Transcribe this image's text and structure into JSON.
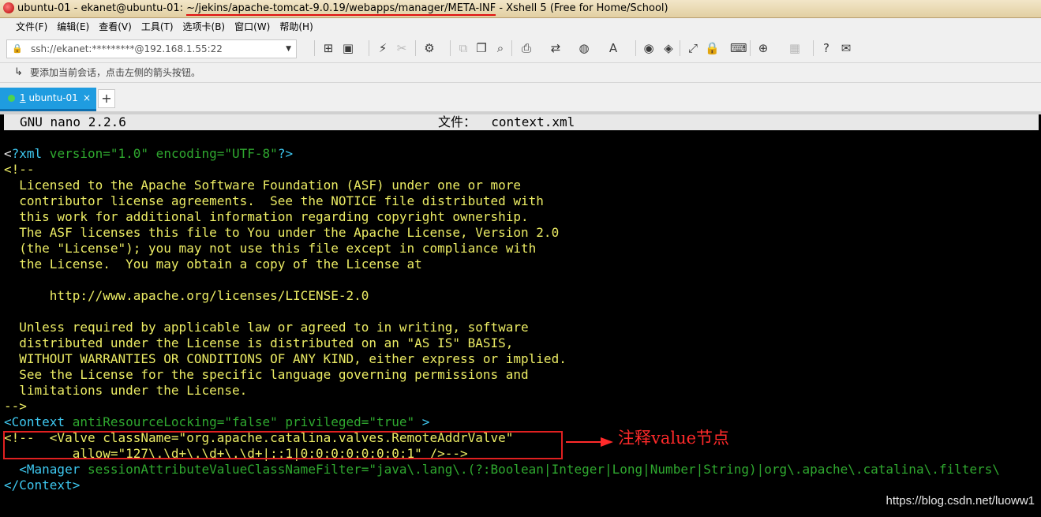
{
  "window": {
    "title_prefix": "ubuntu-01 - ekanet@ubuntu-01: ",
    "title_path": "~/jekins/apache-tomcat-9.0.19/webapps/manager/META-INF",
    "title_suffix": " - Xshell 5 (Free for Home/School)"
  },
  "menu": [
    "文件(F)",
    "编辑(E)",
    "查看(V)",
    "工具(T)",
    "选项卡(B)",
    "窗口(W)",
    "帮助(H)"
  ],
  "address": {
    "value": "ssh://ekanet:*********@192.168.1.55:22",
    "lock_glyph": "🔒",
    "dropdown_glyph": "▼"
  },
  "toolbar_icons": [
    {
      "name": "new-session-icon",
      "glyph": "⊞",
      "enabled": true
    },
    {
      "name": "open-folder-icon",
      "glyph": "▣",
      "enabled": true
    },
    {
      "name": "connect-icon",
      "glyph": "⚡",
      "enabled": true
    },
    {
      "name": "disconnect-icon",
      "glyph": "✂",
      "enabled": false
    },
    {
      "name": "properties-icon",
      "glyph": "⚙",
      "enabled": true
    },
    {
      "name": "copy-icon",
      "glyph": "⧉",
      "enabled": false
    },
    {
      "name": "paste-icon",
      "glyph": "❐",
      "enabled": true
    },
    {
      "name": "find-icon",
      "glyph": "⌕",
      "enabled": true
    },
    {
      "name": "print-icon",
      "glyph": "⎙",
      "enabled": true
    },
    {
      "name": "transfer-icon",
      "glyph": "⇄",
      "enabled": true
    },
    {
      "name": "globe-icon",
      "glyph": "◍",
      "enabled": true
    },
    {
      "name": "font-icon",
      "glyph": "A",
      "enabled": true
    },
    {
      "name": "xftp-icon",
      "glyph": "◉",
      "enabled": true
    },
    {
      "name": "xmanager-icon",
      "glyph": "◈",
      "enabled": true
    },
    {
      "name": "fullscreen-icon",
      "glyph": "⤢",
      "enabled": true
    },
    {
      "name": "lock-icon",
      "glyph": "🔒",
      "enabled": true
    },
    {
      "name": "keyboard-icon",
      "glyph": "⌨",
      "enabled": true
    },
    {
      "name": "add-tab-icon",
      "glyph": "⊕",
      "enabled": true
    },
    {
      "name": "layout-icon",
      "glyph": "▦",
      "enabled": false
    },
    {
      "name": "help-icon",
      "glyph": "?",
      "enabled": true
    },
    {
      "name": "chat-icon",
      "glyph": "✉",
      "enabled": true
    }
  ],
  "hint": {
    "icon_glyph": "↳",
    "text": "要添加当前会话，点击左侧的箭头按钮。"
  },
  "tabs": [
    {
      "number": "1",
      "label": " ubuntu-01",
      "close_glyph": "×",
      "status_color": "#4ed24e"
    }
  ],
  "add_tab_glyph": "+",
  "nano": {
    "version": "GNU nano 2.2.6",
    "file_label": "文件：  context.xml"
  },
  "colors": {
    "comment": "#ecec64",
    "tag": "#3ec8f0",
    "attribute": "#2fa82f",
    "value": "#ececec",
    "annotation": "#ff2a2a"
  },
  "editor_lines": [
    [
      {
        "t": "<",
        "c": "cursor"
      },
      {
        "t": "?xml",
        "c": "tag"
      },
      {
        "t": " version=",
        "c": "attr"
      },
      {
        "t": "\"1.0\"",
        "c": "attr"
      },
      {
        "t": " encoding=",
        "c": "attr"
      },
      {
        "t": "\"UTF-8\"",
        "c": "attr"
      },
      {
        "t": "?>",
        "c": "tag"
      }
    ],
    [
      {
        "t": "<!--",
        "c": "com"
      }
    ],
    [
      {
        "t": "  Licensed to the Apache Software Foundation (ASF) under one or more",
        "c": "com"
      }
    ],
    [
      {
        "t": "  contributor license agreements.  See the NOTICE file distributed with",
        "c": "com"
      }
    ],
    [
      {
        "t": "  this work for additional information regarding copyright ownership.",
        "c": "com"
      }
    ],
    [
      {
        "t": "  The ASF licenses this file to You under the Apache License, Version 2.0",
        "c": "com"
      }
    ],
    [
      {
        "t": "  (the \"License\"); you may not use this file except in compliance with",
        "c": "com"
      }
    ],
    [
      {
        "t": "  the License.  You may obtain a copy of the License at",
        "c": "com"
      }
    ],
    [
      {
        "t": "",
        "c": "com"
      }
    ],
    [
      {
        "t": "      http://www.apache.org/licenses/LICENSE-2.0",
        "c": "com"
      }
    ],
    [
      {
        "t": "",
        "c": "com"
      }
    ],
    [
      {
        "t": "  Unless required by applicable law or agreed to in writing, software",
        "c": "com"
      }
    ],
    [
      {
        "t": "  distributed under the License is distributed on an \"AS IS\" BASIS,",
        "c": "com"
      }
    ],
    [
      {
        "t": "  WITHOUT WARRANTIES OR CONDITIONS OF ANY KIND, either express or implied.",
        "c": "com"
      }
    ],
    [
      {
        "t": "  See the License for the specific language governing permissions and",
        "c": "com"
      }
    ],
    [
      {
        "t": "  limitations under the License.",
        "c": "com"
      }
    ],
    [
      {
        "t": "-->",
        "c": "com"
      }
    ],
    [
      {
        "t": "<Context",
        "c": "tag"
      },
      {
        "t": " antiResourceLocking=\"false\" privileged=\"true\"",
        "c": "attr"
      },
      {
        "t": " >",
        "c": "tag"
      }
    ],
    [
      {
        "t": "<!--  <Valve className=\"org.apache.catalina.valves.RemoteAddrValve\"",
        "c": "com"
      }
    ],
    [
      {
        "t": "         allow=\"127\\.\\d+\\.\\d+\\.\\d+|::1|0:0:0:0:0:0:0:1\" />-->",
        "c": "com"
      }
    ],
    [
      {
        "t": "  <Manager",
        "c": "tag"
      },
      {
        "t": " sessionAttributeValueClassNameFilter=\"java\\.lang\\.(?:Boolean|Integer|Long|Number|String)|org\\.apache\\.catalina\\.filters\\",
        "c": "attr"
      }
    ],
    [
      {
        "t": "</Context>",
        "c": "tag"
      }
    ]
  ],
  "annotation": {
    "text": "注释value节点"
  },
  "watermark": "https://blog.csdn.net/luoww1"
}
